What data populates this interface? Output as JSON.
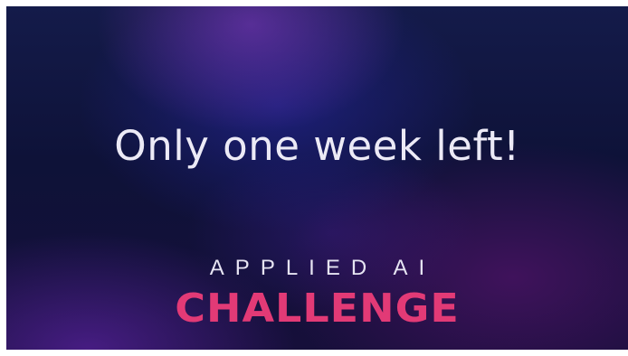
{
  "headline": "Only one week left!",
  "brand": {
    "kicker": "APPLIED AI",
    "wordmark": "CHALLENGE"
  },
  "colors": {
    "headline_text": "#eceaf6",
    "kicker_text": "#e6e4f2",
    "wordmark_accent": "#e23a76",
    "background_base": "#0e1238"
  }
}
